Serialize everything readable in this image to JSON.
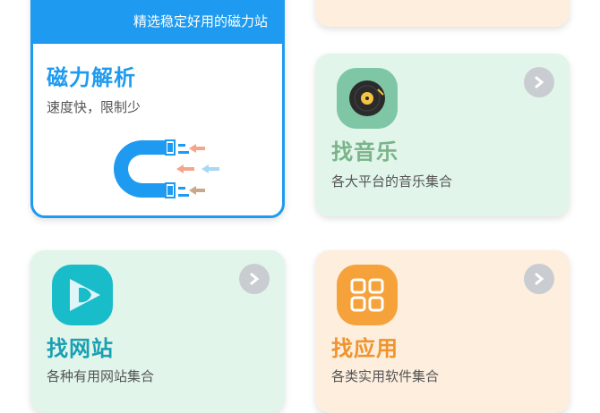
{
  "magnet_card": {
    "banner_text": "精选稳定好用的磁力站",
    "title": "磁力解析",
    "subtitle": "速度快，限制少"
  },
  "music_card": {
    "title": "找音乐",
    "subtitle": "各大平台的音乐集合",
    "icon": "vinyl-record-icon"
  },
  "website_card": {
    "title": "找网站",
    "subtitle": "各种有用网站集合",
    "icon": "play-fish-icon"
  },
  "app_card": {
    "title": "找应用",
    "subtitle": "各类实用软件集合",
    "icon": "app-grid-icon"
  },
  "colors": {
    "accent_blue": "#1e9bf0",
    "green_card_bg": "#e1f5ea",
    "peach_card_bg": "#fdeede",
    "green_title": "#79b489",
    "orange_title": "#f0932b",
    "magnet_title": "#1e9bf0"
  }
}
